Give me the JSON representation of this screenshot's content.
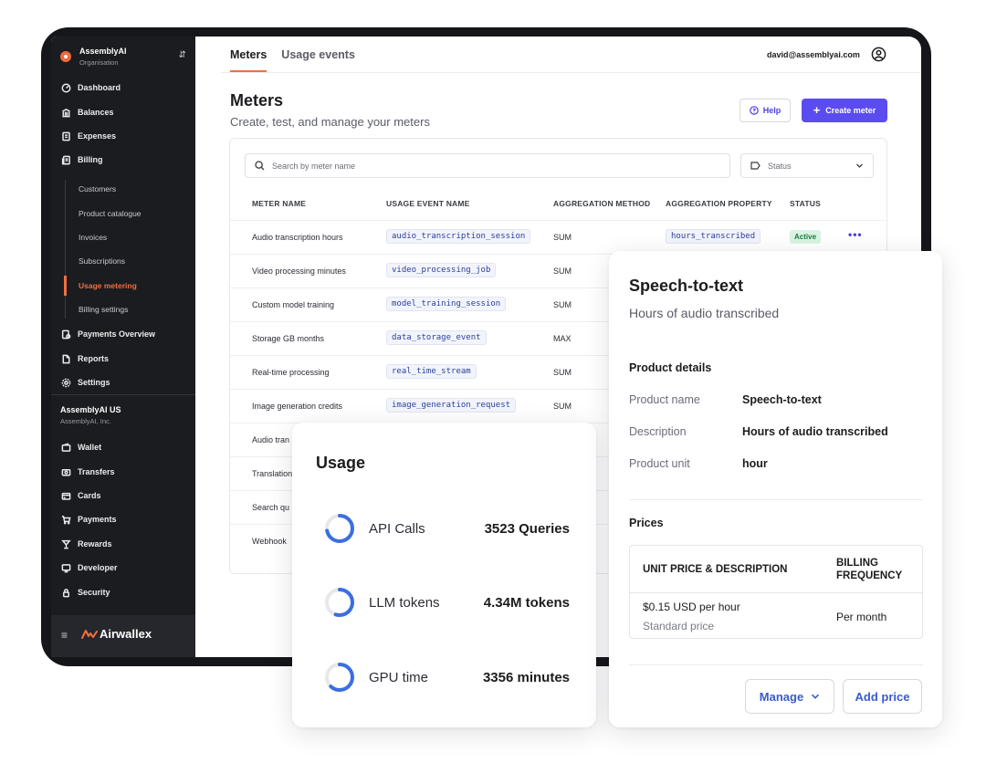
{
  "org": {
    "name": "AssemblyAI",
    "subtitle": "Organisation"
  },
  "sidebar": {
    "items": [
      {
        "label": "Dashboard",
        "icon": "dashboard-icon"
      },
      {
        "label": "Balances",
        "icon": "bank-icon"
      },
      {
        "label": "Expenses",
        "icon": "receipt-icon"
      },
      {
        "label": "Billing",
        "icon": "billing-icon"
      }
    ],
    "billing_sub": [
      {
        "label": "Customers"
      },
      {
        "label": "Product catalogue"
      },
      {
        "label": "Invoices"
      },
      {
        "label": "Subscriptions"
      },
      {
        "label": "Usage metering",
        "active": true
      },
      {
        "label": "Billing settings"
      }
    ],
    "items2": [
      {
        "label": "Payments Overview",
        "icon": "payments-overview-icon"
      },
      {
        "label": "Reports",
        "icon": "document-icon"
      },
      {
        "label": "Settings",
        "icon": "gear-icon"
      }
    ],
    "entity": {
      "name": "AssemblyAI US",
      "subtitle": "AssemblyAI, Inc."
    },
    "items3": [
      {
        "label": "Wallet",
        "icon": "wallet-icon"
      },
      {
        "label": "Transfers",
        "icon": "transfers-icon"
      },
      {
        "label": "Cards",
        "icon": "card-icon"
      },
      {
        "label": "Payments",
        "icon": "cart-icon"
      },
      {
        "label": "Rewards",
        "icon": "trophy-icon"
      },
      {
        "label": "Developer",
        "icon": "monitor-icon"
      },
      {
        "label": "Security",
        "icon": "lock-icon"
      }
    ],
    "footer_brand": "Airwallex"
  },
  "header": {
    "tabs": [
      {
        "label": "Meters",
        "active": true
      },
      {
        "label": "Usage events"
      }
    ],
    "user_email": "david@assemblyai.com"
  },
  "page": {
    "title": "Meters",
    "subtitle": "Create, test, and manage your meters",
    "help_label": "Help",
    "create_label": "Create meter"
  },
  "filters": {
    "search_placeholder": "Search by meter name",
    "status_placeholder": "Status"
  },
  "table": {
    "columns": [
      "METER NAME",
      "USAGE EVENT NAME",
      "AGGREGATION METHOD",
      "AGGREGATION PROPERTY",
      "STATUS"
    ],
    "rows": [
      {
        "name": "Audio transcription hours",
        "event": "audio_transcription_session",
        "method": "SUM",
        "property": "hours_transcribed",
        "status": "Active"
      },
      {
        "name": "Video processing minutes",
        "event": "video_processing_job",
        "method": "SUM"
      },
      {
        "name": "Custom model training",
        "event": "model_training_session",
        "method": "SUM"
      },
      {
        "name": "Storage GB months",
        "event": "data_storage_event",
        "method": "MAX"
      },
      {
        "name": "Real-time processing",
        "event": "real_time_stream",
        "method": "SUM"
      },
      {
        "name": "Image generation credits",
        "event": "image_generation_request",
        "method": "SUM"
      },
      {
        "name": "Audio tran"
      },
      {
        "name": "Translation"
      },
      {
        "name": "Search qu"
      },
      {
        "name": "Webhook"
      }
    ]
  },
  "usage": {
    "title": "Usage",
    "items": [
      {
        "label": "API Calls",
        "value": "3523 Queries",
        "fill": 0.72
      },
      {
        "label": "LLM tokens",
        "value": "4.34M tokens",
        "fill": 0.55
      },
      {
        "label": "GPU time",
        "value": "3356 minutes",
        "fill": 0.62
      }
    ]
  },
  "product": {
    "title": "Speech-to-text",
    "subtitle": "Hours of audio transcribed",
    "details_heading": "Product details",
    "details": [
      {
        "key": "Product name",
        "value": "Speech-to-text"
      },
      {
        "key": "Description",
        "value": "Hours of audio transcribed"
      },
      {
        "key": "Product unit",
        "value": "hour"
      }
    ],
    "prices_heading": "Prices",
    "price_header_unit": "UNIT PRICE & DESCRIPTION",
    "price_header_freq": "BILLING FREQUENCY",
    "price": {
      "amount": "$0.15 USD per hour",
      "description": "Standard price",
      "frequency": "Per month"
    },
    "manage_label": "Manage",
    "add_price_label": "Add price"
  },
  "colors": {
    "accent": "#f0703f",
    "primary": "#5b4cf0",
    "link": "#3a5bd0",
    "active_badge_bg": "#d8f4e2"
  }
}
